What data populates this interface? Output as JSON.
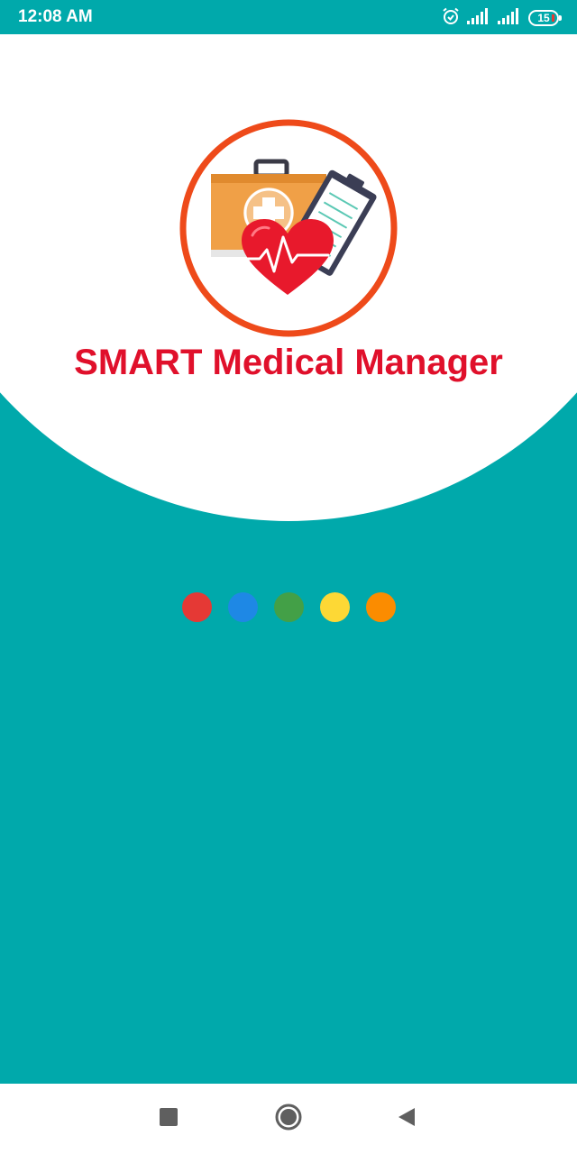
{
  "status_bar": {
    "time": "12:08 AM",
    "battery": "15",
    "icons": [
      "alarm-icon",
      "signal-icon",
      "signal-icon",
      "battery-icon"
    ]
  },
  "app": {
    "title": "SMART Medical Manager",
    "logo": "medical-kit-heart-clipboard-logo"
  },
  "loader": {
    "dots": [
      {
        "name": "dot-red",
        "color": "#E53935"
      },
      {
        "name": "dot-blue",
        "color": "#1E88E5"
      },
      {
        "name": "dot-green",
        "color": "#43A047"
      },
      {
        "name": "dot-yellow",
        "color": "#FDD835"
      },
      {
        "name": "dot-orange",
        "color": "#FB8C00"
      }
    ]
  },
  "colors": {
    "background": "#00A9AB",
    "title": "#E0102B",
    "logo_ring": "#EE4A1A"
  },
  "nav_bar": {
    "buttons": [
      "recents-square-icon",
      "home-circle-icon",
      "back-triangle-icon"
    ]
  }
}
